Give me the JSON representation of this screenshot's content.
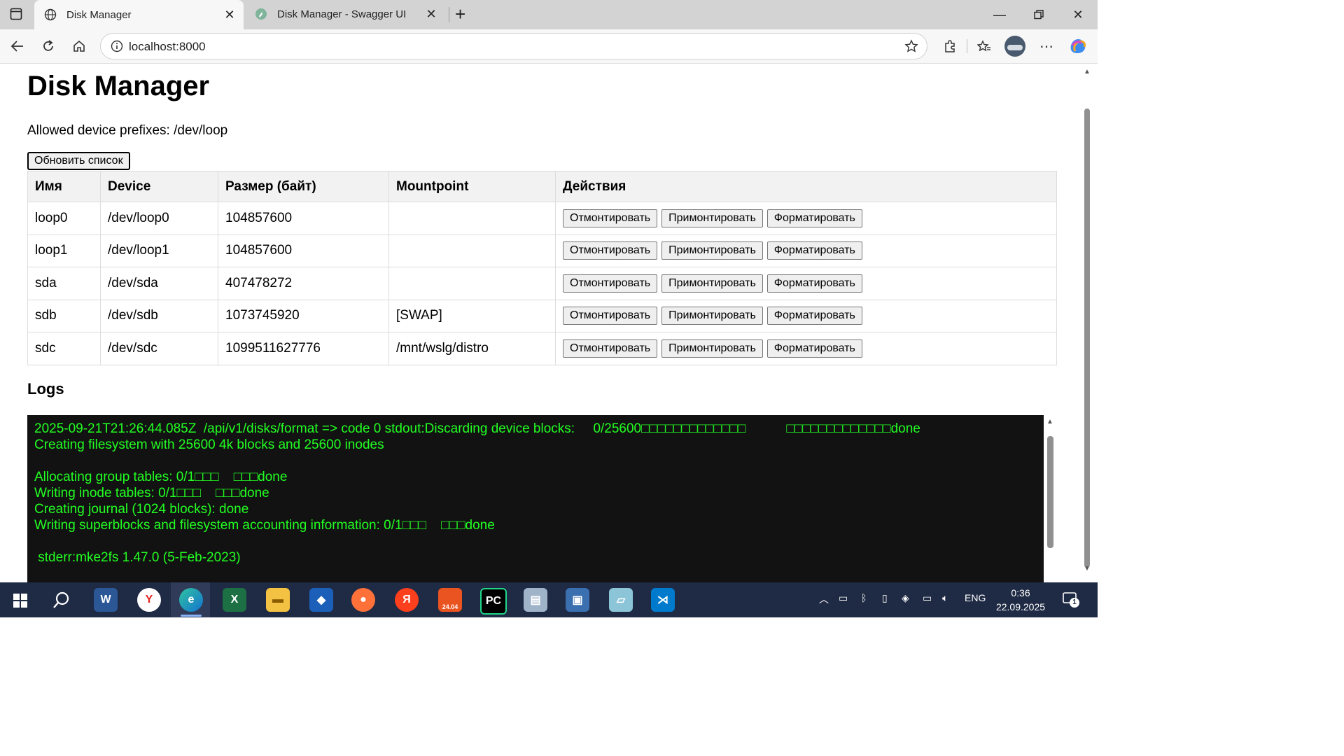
{
  "browser": {
    "tabs": [
      {
        "title": "Disk Manager",
        "icon": "globe-icon",
        "active": true
      },
      {
        "title": "Disk Manager - Swagger UI",
        "icon": "swagger-icon",
        "active": false
      }
    ],
    "url": "localhost:8000"
  },
  "page": {
    "title": "Disk Manager",
    "prefixes_label": "Allowed device prefixes: /dev/loop",
    "refresh_label": "Обновить список",
    "columns": [
      "Имя",
      "Device",
      "Размер (байт)",
      "Mountpoint",
      "Действия"
    ],
    "rows": [
      {
        "name": "loop0",
        "device": "/dev/loop0",
        "size": "104857600",
        "mountpoint": ""
      },
      {
        "name": "loop1",
        "device": "/dev/loop1",
        "size": "104857600",
        "mountpoint": ""
      },
      {
        "name": "sda",
        "device": "/dev/sda",
        "size": "407478272",
        "mountpoint": ""
      },
      {
        "name": "sdb",
        "device": "/dev/sdb",
        "size": "1073745920",
        "mountpoint": "[SWAP]"
      },
      {
        "name": "sdc",
        "device": "/dev/sdc",
        "size": "1099511627776",
        "mountpoint": "/mnt/wslg/distro"
      }
    ],
    "actions": {
      "unmount": "Отмонтировать",
      "mount": "Примонтировать",
      "format": "Форматировать"
    },
    "logs_heading": "Logs",
    "logs_text": "2025-09-21T21:26:44.085Z  /api/v1/disks/format => code 0 stdout:Discarding device blocks:     0/25600□□□□□□□□□□□□□           □□□□□□□□□□□□□done\nCreating filesystem with 25600 4k blocks and 25600 inodes\n\nAllocating group tables: 0/1□□□    □□□done\nWriting inode tables: 0/1□□□    □□□done\nCreating journal (1024 blocks): done\nWriting superblocks and filesystem accounting information: 0/1□□□    □□□done\n\n stderr:mke2fs 1.47.0 (5-Feb-2023)"
  },
  "taskbar": {
    "lang": "ENG",
    "time": "0:36",
    "date": "22.09.2025",
    "notification_count": "1",
    "ubuntu_badge": "24.04"
  },
  "colors": {
    "log_bg": "#121212",
    "log_text": "#22ff22",
    "taskbar": "#1f2a44"
  }
}
